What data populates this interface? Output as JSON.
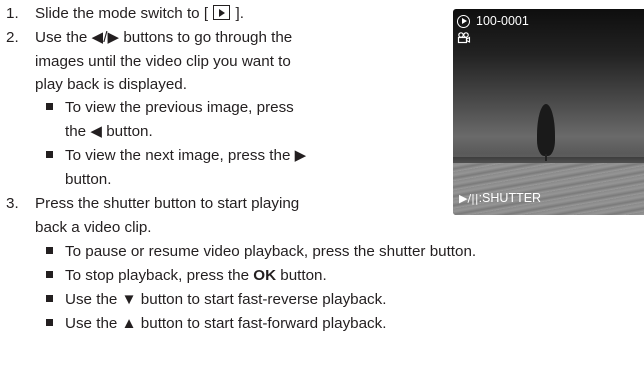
{
  "steps": [
    {
      "num": "1.",
      "before": "Slide the mode switch to [",
      "after": "]."
    },
    {
      "num": "2.",
      "line1": "Use the ◀/▶ buttons to go through the",
      "line2": "images until the video clip you want to",
      "line3": "play back is displayed."
    },
    {
      "num": "3.",
      "line1": "Press the shutter button to start playing",
      "line2": "back a video clip."
    }
  ],
  "step2_bullets": [
    {
      "line1": "To view the previous image, press",
      "line2": "the ◀ button."
    },
    {
      "line1": "To view the next image, press the ▶",
      "line2": "button."
    }
  ],
  "step3_bullets": [
    {
      "before": "To pause or resume video playback, press the shutter button.",
      "bold": "",
      "after": ""
    },
    {
      "before": "To stop playback, press the ",
      "bold": "OK",
      "after": " button."
    },
    {
      "before": "Use the ▼ button to start fast-reverse playback.",
      "bold": "",
      "after": ""
    },
    {
      "before": "Use the ▲ button to start fast-forward playback.",
      "bold": "",
      "after": ""
    }
  ],
  "lcd": {
    "file_number": "100-0001",
    "bottom_glyph": "▶/||",
    "bottom_label": ":SHUTTER",
    "icons": [
      "play-mode-icon",
      "video-clip-icon"
    ]
  }
}
